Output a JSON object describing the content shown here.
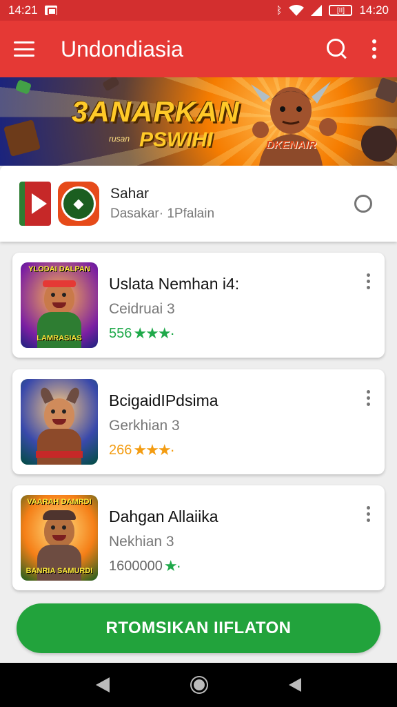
{
  "status_bar": {
    "time_left": "14:21",
    "time_right": "14:20",
    "battery_label": "[II]"
  },
  "app_bar": {
    "title": "Undondiasia"
  },
  "banner": {
    "title": "3ANARKAN",
    "subtitle_small": "rusan",
    "subtitle": "PSWIHI",
    "tag": "DKENAIR"
  },
  "featured": {
    "title": "Sahar",
    "subtitle": "Dasakar· 1Pfalain"
  },
  "cards": [
    {
      "title": "Uslata Nemhan i4:",
      "subtitle": "Ceidruai 3",
      "rating_value": "556",
      "stars": "★★★·",
      "accent": "#1fa94a",
      "thumb_top": "YLODAI DALPAN",
      "thumb_caption": "LAMRASIAS"
    },
    {
      "title": "BcigaidIPdsima",
      "subtitle": "Gerkhian 3",
      "rating_value": "266",
      "stars": "★★★·",
      "accent": "#f39c12",
      "thumb_top": "",
      "thumb_caption": ""
    },
    {
      "title": "Dahgan Allaiika",
      "subtitle": "Nekhian 3",
      "rating_value": "1600000",
      "stars": "★·",
      "accent": "#1fa94a",
      "thumb_top": "VAARAH DAMRDI",
      "thumb_caption": "BANRIA SAMURDI"
    }
  ],
  "cta": {
    "label": "RTOMSIKAN IIFLATON"
  },
  "colors": {
    "primary": "#e53935",
    "status_bar": "#d32f2f",
    "cta": "#22a33c",
    "rating_green": "#1fa94a",
    "rating_orange": "#f39c12"
  },
  "icons": {
    "menu": "menu-icon",
    "search": "search-icon",
    "overflow": "overflow-icon",
    "radio": "radio-icon",
    "back": "back-icon",
    "home": "home-icon",
    "recent": "recent-icon"
  }
}
